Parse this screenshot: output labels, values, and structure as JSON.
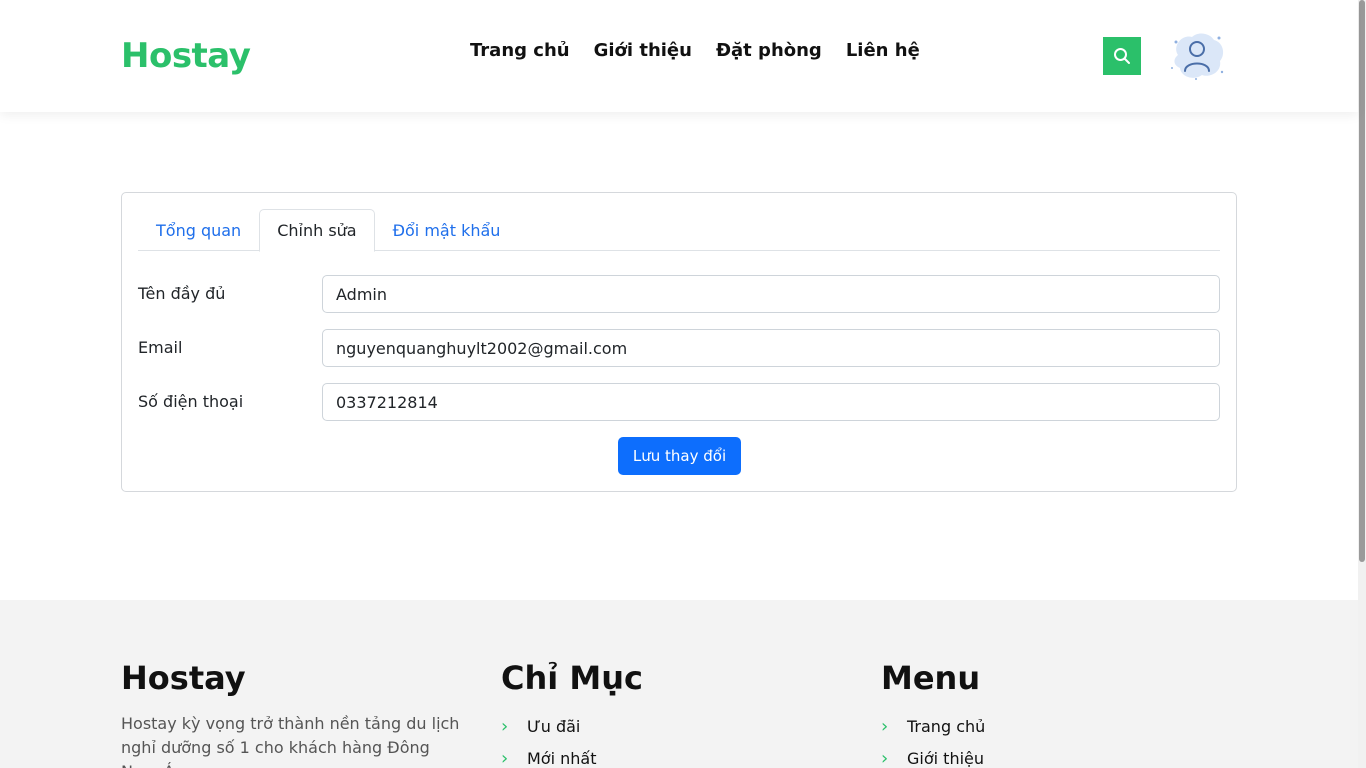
{
  "header": {
    "logo": "Hostay",
    "nav": [
      "Trang chủ",
      "Giới thiệu",
      "Đặt phòng",
      "Liên hệ"
    ]
  },
  "tabs": [
    {
      "label": "Tổng quan",
      "active": false
    },
    {
      "label": "Chỉnh sửa",
      "active": true
    },
    {
      "label": "Đổi mật khẩu",
      "active": false
    }
  ],
  "form": {
    "fullname_label": "Tên đầy đủ",
    "fullname_value": "Admin",
    "email_label": "Email",
    "email_value": "nguyenquanghuylt2002@gmail.com",
    "phone_label": "Số điện thoại",
    "phone_value": "0337212814",
    "save_label": "Lưu thay đổi"
  },
  "footer": {
    "about_title": "Hostay",
    "about_text": "Hostay kỳ vọng trở thành nền tảng du lịch nghỉ dưỡng số 1 cho khách hàng Đông Nam Á",
    "index_title": "Chỉ Mục",
    "index_items": [
      "Ưu đãi",
      "Mới nhất"
    ],
    "menu_title": "Menu",
    "menu_items": [
      "Trang chủ",
      "Giới thiệu"
    ]
  },
  "colors": {
    "brand": "#2bc06a",
    "primary": "#0d6efd"
  }
}
